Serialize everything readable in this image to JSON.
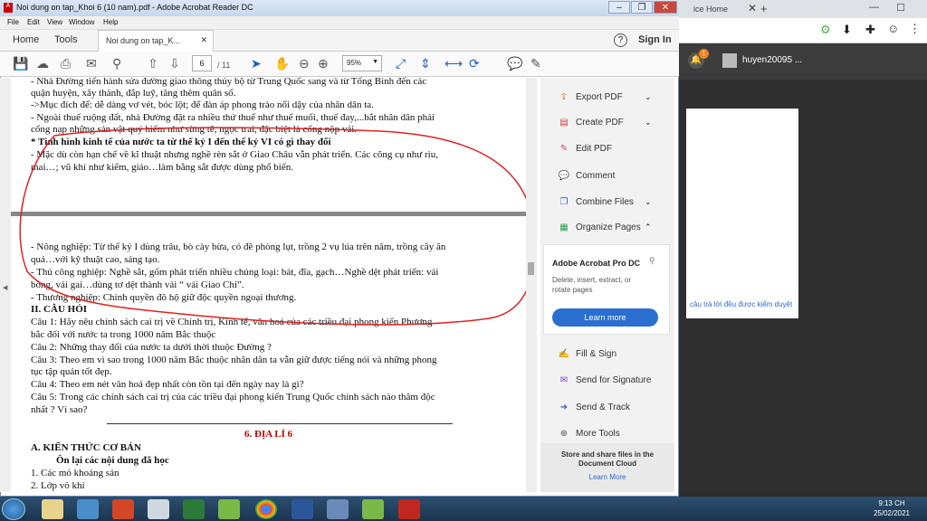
{
  "window": {
    "title": "Noi dung on tap_Khoi 6 (10 nam).pdf - Adobe Acrobat Reader DC"
  },
  "menu": [
    "File",
    "Edit",
    "View",
    "Window",
    "Help"
  ],
  "nav": {
    "home": "Home",
    "tools": "Tools",
    "doc_tab": "Noi dung on tap_K...",
    "help": "?",
    "sign_in": "Sign In"
  },
  "toolbar": {
    "page_current": "6",
    "page_total": "/ 11",
    "zoom": "95%"
  },
  "document": {
    "lines": [
      "- Nhà Đường tiến hành sửa đường giao thông thủy bộ từ Trung Quốc sang và từ Tống Bình đến các",
      "quận huyện, xây thành, đắp luỹ, tăng thêm quân số.",
      "->Mục đích để: dễ dàng vơ vét, bóc lột; để đàn áp phong trào nổi dậy của nhân dân ta.",
      "- Ngoài thuế ruộng đất, nhà Đường đặt ra nhiều thứ thuế như thuế muối, thuế đay,...bắt nhân dân phải",
      "cống nạp những sản vật quý hiếm như sừng tê, ngọc trai, đặc biệt là cống nộp vải.",
      "* Tình hình kinh tế của nước ta từ thế kỷ I đến thế kỷ VI có gì thay đổi",
      "- Mặc dù còn hạn chế về kĩ thuật nhưng nghề rèn sắt ở Giao Châu vẫn phát triển. Các công cụ như rìu,",
      "mai…; vũ khí như kiếm, giáo…làm bằng sắt được dùng phổ biến.",
      "- Nông nghiệp: Từ thế kỷ I dùng trâu, bò cày bừa, có đê phòng lụt, trồng 2 vụ lúa trên năm, trồng cây ăn",
      "quả…với kỹ thuật cao, sáng tạo.",
      "- Thủ công nghiệp: Nghề sắt, gốm phát triển nhiều chủng loại: bát, đĩa, gạch…Nghề dệt phát triển: vải",
      "bông, vải gai…dùng tơ dệt thành vải “ vải Giao Chỉ”.",
      "- Thương nghiệp: Chính quyền đô hộ giữ độc quyền ngoại thương.",
      "II. CÂU HỎI",
      "Câu 1: Hãy nêu chính sách cai trị về Chính trị, Kinh tế, văn hoá của các triều đại phong kiến Phương",
      "bắc đối với nước ta trong 1000 năm Bắc thuộc",
      "Câu 2: Những thay đổi của nước ta dưới thời thuộc Đường ?",
      "Câu 3: Theo em vì sao trong 1000 năm Bắc thuộc nhân dân ta vẫn giữ được tiếng nói và những phong",
      "tục tập quán tốt đẹp.",
      "Câu 4: Theo em nét văn hoá đẹp nhất còn tồn tại đến ngày nay là gì?",
      "Câu 5: Trong các chính sách cai trị của các triều đại phong kiến Trung Quốc chính sách nào thâm độc",
      "nhất ? Vì sao?",
      "6. ĐỊA LÍ 6",
      "A. KIẾN THỨC CƠ BẢN",
      "Ôn lại các nội dung đã học",
      "1. Các mỏ khoáng sản",
      "2. Lớp vỏ khí"
    ]
  },
  "pane": {
    "items": [
      "Export PDF",
      "Create PDF",
      "Edit PDF",
      "Comment",
      "Combine Files",
      "Organize Pages"
    ],
    "promo_title": "Adobe Acrobat Pro DC",
    "promo_text": [
      "Delete, insert, extract, or",
      "rotate pages"
    ],
    "learn_more": "Learn more",
    "items2": [
      "Fill & Sign",
      "Send for Signature",
      "Send & Track",
      "More Tools"
    ],
    "cloud_text": [
      "Store and share files in the",
      "Document Cloud"
    ],
    "cloud_link": "Learn More"
  },
  "chrome": {
    "tab_label": "ice Home",
    "username": "huyen20095 ...",
    "link_text": "câu trả lời đều được kiểm duyệt",
    "badge": "1"
  },
  "taskbar": {
    "time": "9:13 CH",
    "date": "25/02/2021"
  },
  "colors": {
    "annotation": "#e02020",
    "accent": "#2a6ecf",
    "heading_red": "#c00000"
  }
}
